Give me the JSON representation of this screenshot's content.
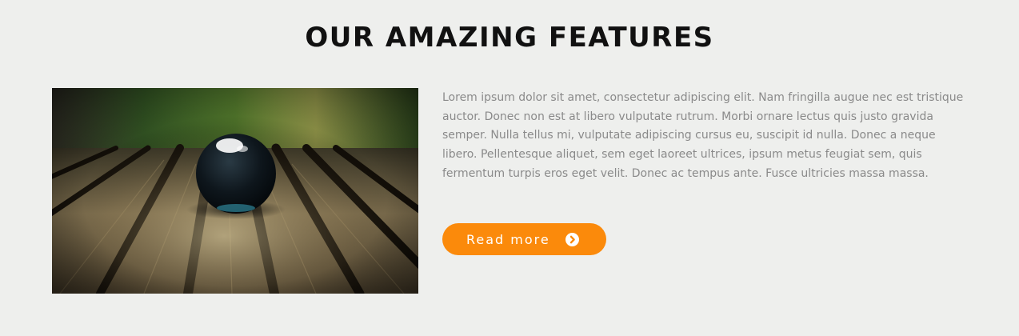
{
  "section": {
    "title": "OUR AMAZING FEATURES"
  },
  "feature": {
    "image_icon": "glass-marble-on-wooden-planks-image",
    "description": "Lorem ipsum dolor sit amet, consectetur adipiscing elit. Nam fringilla augue nec est tristique auctor. Donec non est at libero vulputate rutrum. Morbi ornare lectus quis justo gravida semper. Nulla tellus mi, vulputate adipiscing cursus eu, suscipit id nulla. Donec a neque libero. Pellentesque aliquet, sem eget laoreet ultrices, ipsum metus feugiat sem, quis fermentum turpis eros eget velit. Donec ac tempus ante. Fusce ultricies massa massa.",
    "button_label": "Read more",
    "button_icon": "chevron-circle-right-icon"
  },
  "colors": {
    "background": "#eeefed",
    "title": "#111111",
    "body_text": "#8a8a8a",
    "accent": "#fb8a0b",
    "button_text": "#ffffff"
  }
}
